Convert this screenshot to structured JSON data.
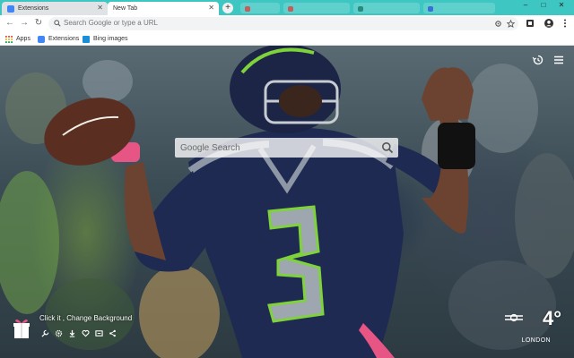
{
  "browser": {
    "tabs": [
      {
        "label": "Extensions",
        "active": false
      },
      {
        "label": "New Tab",
        "active": true
      }
    ],
    "omnibox_placeholder": "Search Google or type a URL",
    "bookmarks": [
      {
        "label": "Apps",
        "icon": "apps-grid-icon"
      },
      {
        "label": "Extensions",
        "icon": "puzzle-icon"
      },
      {
        "label": "Bing images",
        "icon": "bing-icon"
      }
    ]
  },
  "newtab": {
    "search_label": "Google Search",
    "change_background_label": "Click it , Change Background",
    "weather": {
      "temperature": "4°",
      "city": "LONDON",
      "icon": "fog-icon"
    },
    "colors": {
      "tabbar": "#3ec6c3",
      "jersey_navy": "#1f2a52",
      "jersey_green": "#7fd33a",
      "glove_pink": "#e75585"
    }
  }
}
